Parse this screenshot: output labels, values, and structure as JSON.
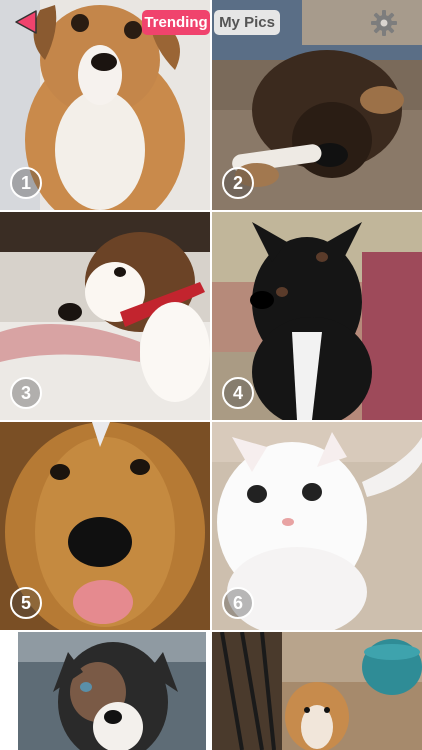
{
  "header": {
    "tabs": [
      {
        "label": "Trending",
        "active": true
      },
      {
        "label": "My Pics",
        "active": false
      }
    ],
    "back_icon": "back-triangle-icon",
    "settings_icon": "gear-icon",
    "accent_color": "#f0436d"
  },
  "photos": [
    {
      "rank": "1",
      "subject": "puppy"
    },
    {
      "rank": "2",
      "subject": "german-shepherd-puppy"
    },
    {
      "rank": "3",
      "subject": "beagle-mix"
    },
    {
      "rank": "4",
      "subject": "black-dog"
    },
    {
      "rank": "5",
      "subject": "golden-retriever"
    },
    {
      "rank": "6",
      "subject": "white-kitten"
    },
    {
      "rank": "",
      "subject": "aussie-puppy"
    },
    {
      "rank": "",
      "subject": "small-dog-outdoors"
    }
  ]
}
